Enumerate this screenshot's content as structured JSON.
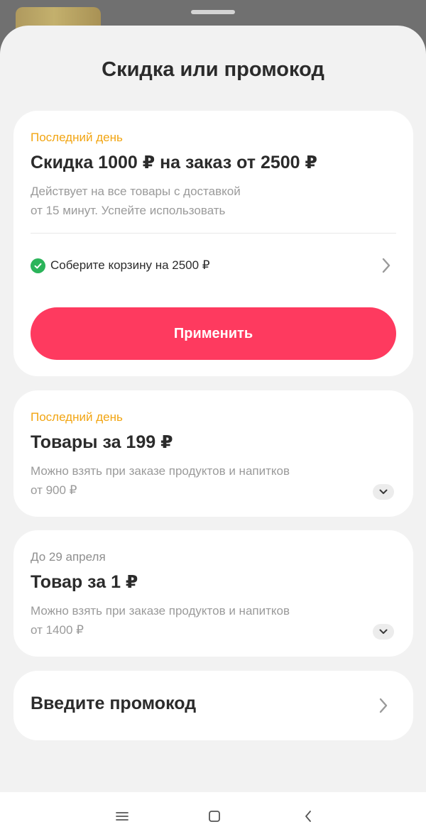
{
  "sheet": {
    "title": "Скидка или промокод"
  },
  "offers": [
    {
      "tag": "Последний день",
      "title": "Скидка 1000 ₽ на заказ от 2500 ₽",
      "description_line1": "Действует на все товары с доставкой",
      "description_line2": "от 15 минут. Успейте использовать",
      "condition": "Соберите корзину на 2500 ₽",
      "apply_label": "Применить"
    },
    {
      "tag": "Последний день",
      "title": "Товары за 199 ₽",
      "description_line1": "Можно взять при заказе продуктов и напитков",
      "description_line2": "от 900 ₽"
    },
    {
      "tag": "До 29 апреля",
      "title": "Товар за 1 ₽",
      "description_line1": "Можно взять при заказе продуктов и напитков",
      "description_line2": "от 1400 ₽"
    }
  ],
  "promo": {
    "label": "Введите промокод"
  },
  "colors": {
    "accent": "#fe3a5f",
    "tag_orange": "#f2a512",
    "check_green": "#2bb45a",
    "sheet_bg": "#f2f2f2"
  },
  "icons": {
    "check": "check-circle-icon",
    "chevron_right": "chevron-right-icon",
    "chevron_down": "chevron-down-icon",
    "nav_menu": "menu-icon",
    "nav_home": "home-square-icon",
    "nav_back": "back-icon"
  }
}
